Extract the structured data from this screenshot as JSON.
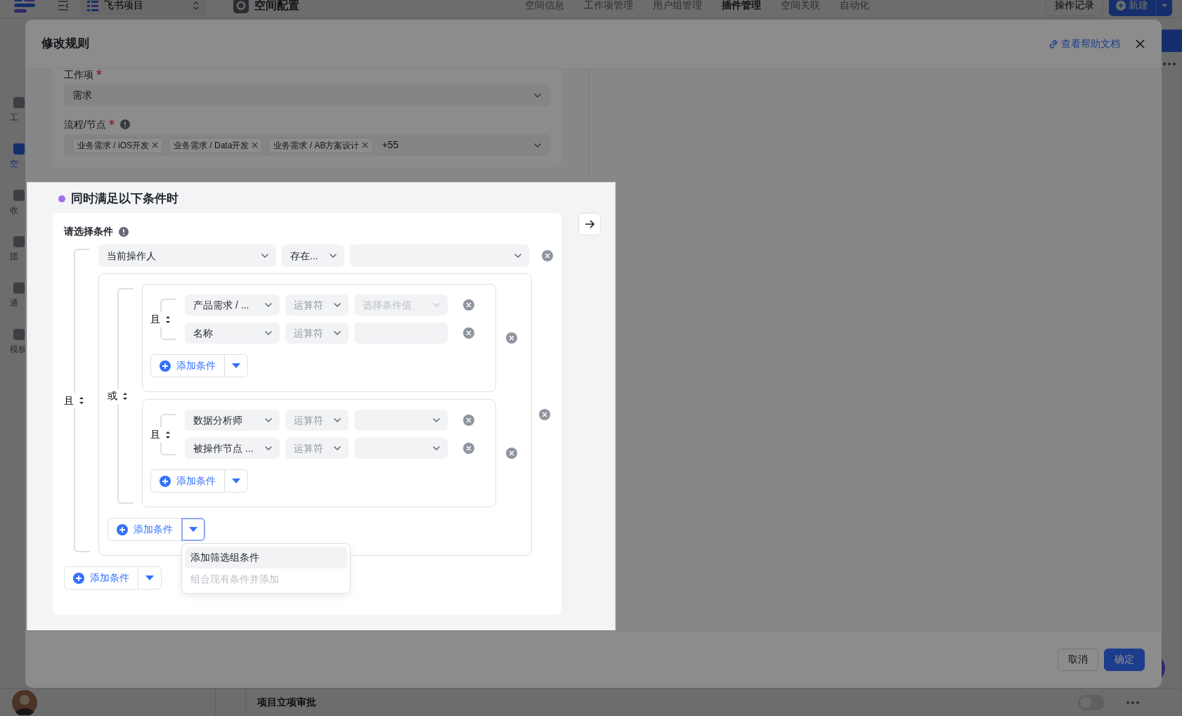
{
  "app": {
    "project": "飞书项目",
    "page_title": "空间配置",
    "nav": [
      {
        "label": "空间信息",
        "selected": false
      },
      {
        "label": "工作项管理",
        "selected": false
      },
      {
        "label": "用户组管理",
        "selected": false
      },
      {
        "label": "插件管理",
        "selected": true
      },
      {
        "label": "空间关联",
        "selected": false
      },
      {
        "label": "自动化",
        "selected": false
      }
    ],
    "history_button": "操作记录",
    "new_button": "新建",
    "sidebar": [
      {
        "label": "工",
        "selected": false
      },
      {
        "label": "空",
        "selected": true
      },
      {
        "label": "收",
        "selected": false
      },
      {
        "label": "团",
        "selected": false
      },
      {
        "label": "通",
        "selected": false
      },
      {
        "label": "模板",
        "selected": false
      }
    ],
    "row_title": "项目立项审批",
    "row_toggle_on": false
  },
  "modal": {
    "title": "修改规则",
    "help_link": "查看帮助文档",
    "fields": [
      {
        "kind": "select",
        "label": "工作项",
        "required": true,
        "info": false,
        "value": "需求"
      },
      {
        "kind": "tags",
        "label": "流程/节点",
        "required": true,
        "info": true,
        "tags": [
          "业务需求 / iOS开发",
          "业务需求 / Data开发",
          "业务需求 / AB方案设计"
        ],
        "more": "+55"
      }
    ],
    "conditions": {
      "title": "同时满足以下条件时",
      "label": "请选择条件",
      "root": {
        "logic": "且",
        "add_label": "添加条件",
        "menu_open": false,
        "items": [
          {
            "kind": "condition",
            "field": "当前操作人",
            "operator": "存在...",
            "value": {
              "kind": "select"
            }
          },
          {
            "kind": "group",
            "logic": "或",
            "add_label": "添加条件",
            "menu_open": true,
            "menu": [
              {
                "label": "添加筛选组条件",
                "selected": true,
                "disabled": false
              },
              {
                "label": "组合现有条件并添加",
                "selected": false,
                "disabled": true
              }
            ],
            "items": [
              {
                "kind": "group",
                "logic": "且",
                "add_label": "添加条件",
                "menu_open": false,
                "items": [
                  {
                    "kind": "condition",
                    "field": "产品需求 / ...",
                    "operator_placeholder": "运算符",
                    "value": {
                      "kind": "select",
                      "placeholder": "选择条件值"
                    }
                  },
                  {
                    "kind": "condition",
                    "field": "名称",
                    "operator_placeholder": "运算符",
                    "value": {
                      "kind": "input"
                    }
                  }
                ]
              },
              {
                "kind": "group",
                "logic": "且",
                "add_label": "添加条件",
                "menu_open": false,
                "items": [
                  {
                    "kind": "condition",
                    "field": "数据分析师",
                    "operator_placeholder": "运算符",
                    "value": {
                      "kind": "select"
                    }
                  },
                  {
                    "kind": "condition",
                    "field": "被操作节点 ...",
                    "operator_placeholder": "运算符",
                    "value": {
                      "kind": "select"
                    }
                  }
                ]
              }
            ]
          }
        ]
      }
    },
    "footer": [
      {
        "label": "取消",
        "kind": "secondary"
      },
      {
        "label": "确定",
        "kind": "primary"
      }
    ]
  }
}
